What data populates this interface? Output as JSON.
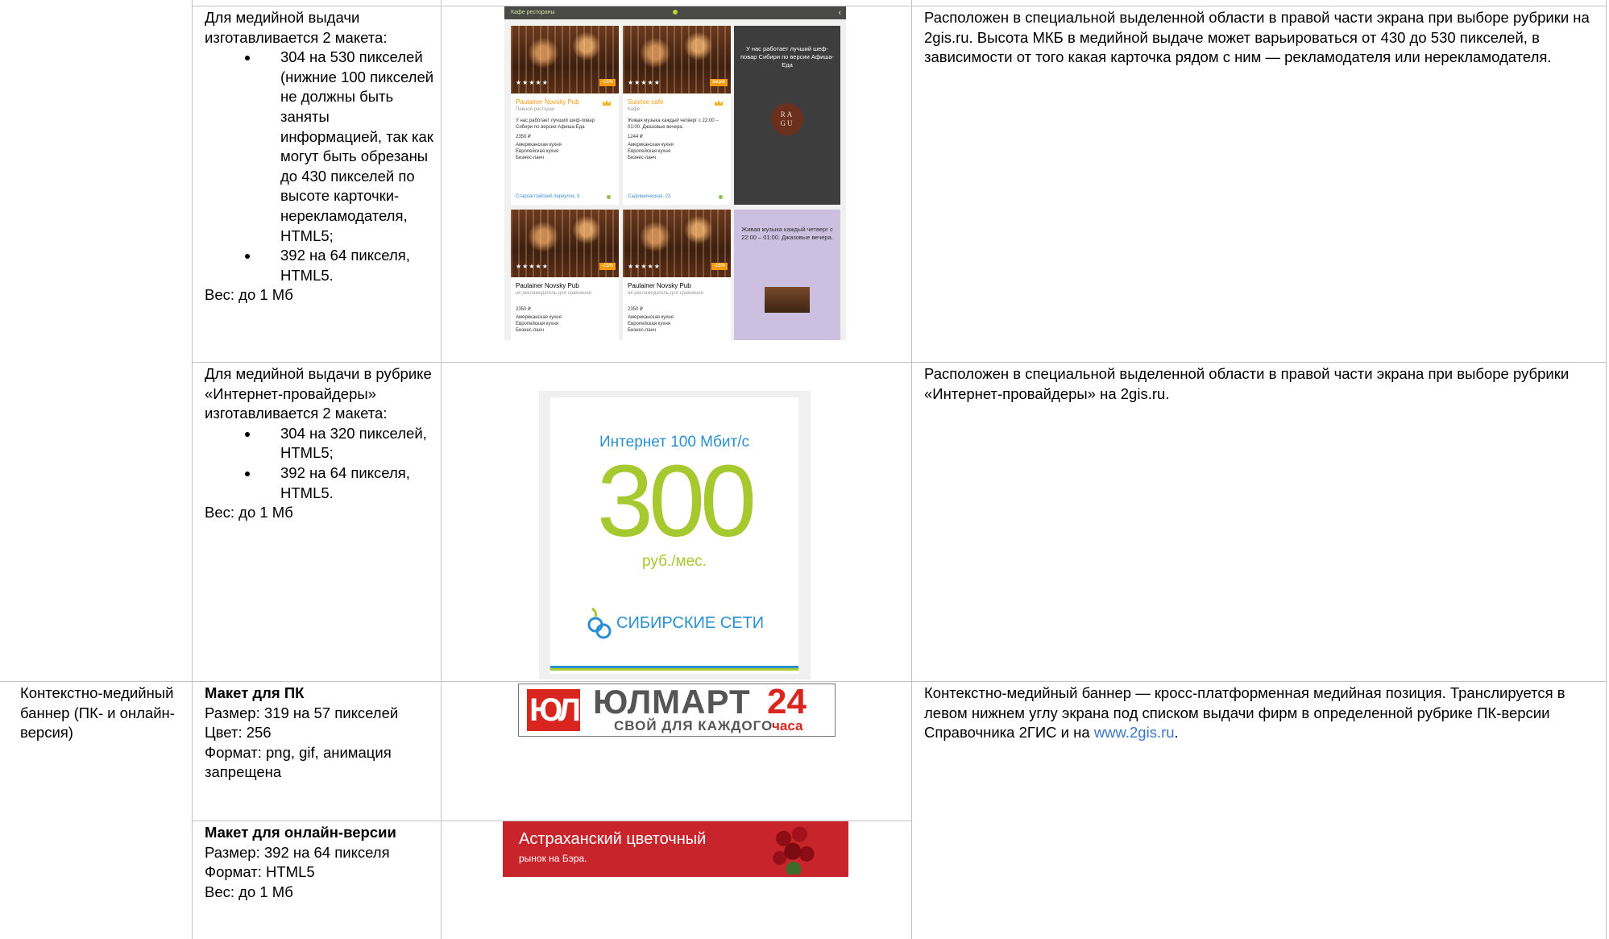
{
  "table": {
    "row1": {
      "col2_intro": "Для медийной выдачи изготавливается 2 макета:",
      "col2_items": [
        "304 на 530 пикселей (нижние 100 пикселей не должны быть заняты информацией, так как могут быть обрезаны до 430 пикселей по высоте карточки-нерекламодателя, HTML5;",
        "392 на 64 пикселя, HTML5."
      ],
      "col2_weight": "Вес: до 1 Мб",
      "col4": "Расположен в специальной выделенной области в правой части экрана при выборе рубрики на 2gis.ru. Высота МКБ в медийной выдаче может варьироваться от 430 до 530 пикселей, в зависимости от того какая карточка рядом с ним — рекламодателя или нерекламодателя."
    },
    "row2": {
      "col2_intro": "Для медийной выдачи в рубрике «Интернет-провайдеры» изготавливается 2 макета:",
      "col2_items": [
        "304 на 320 пикселей, HTML5;",
        "392 на 64 пикселя, HTML5."
      ],
      "col2_weight": "Вес: до 1 Мб",
      "col4": "Расположен в специальной выделенной области в правой части экрана при выборе рубрики «Интернет-провайдеры» на 2gis.ru."
    },
    "row3": {
      "col1": "Контекстно-медийный баннер (ПК- и онлайн-версия)",
      "pc": {
        "heading": "Макет для ПК",
        "lines": [
          "Размер: 319 на 57 пикселей",
          "Цвет: 256",
          "Формат: png, gif, анимация запрещена"
        ]
      },
      "online": {
        "heading": "Макет для онлайн-версии",
        "lines": [
          "Размер: 392 на 64 пикселя",
          "Формат: HTML5",
          "Вес: до 1 Мб"
        ]
      },
      "col4_before": "Контекстно-медийный баннер — кросс-платформенная медийная позиция. Транслируется в левом нижнем углу экрана под списком выдачи фирм в определенной рубрике ПК-версии Справочника 2ГИС и на ",
      "col4_link": "www.2gis.ru",
      "col4_after": "."
    }
  },
  "mockup1": {
    "bar_title": "Кафе рестораны",
    "cards": [
      {
        "title": "Paulainer Novsky Pub",
        "sub": "Пивной ресторан",
        "text": "У нас работает лучший шеф-повар Сибири по версии Афиша-Еда",
        "price": "2350 ₽",
        "cuisine": "Американская кухня\nЕвропейская кухня\nБизнес-ланч",
        "addr": "Староалтайский переулок, 5",
        "badge": "-15%",
        "stars": "★★★★★"
      },
      {
        "title": "Sunrise cafe",
        "sub": "Кафе",
        "text": "Живая музыка каждый четверг с 22:00 – 01:00. Джазовые вечера.",
        "price": "1244 ₽",
        "cuisine": "Американская кухня\nЕвропейская кухня\nБизнес-ланч",
        "addr": "Садовническая, 23",
        "badge": "акция",
        "stars": "★★★★★"
      },
      {
        "title": "Paulainer Novsky Pub",
        "sub": "не рекламодатель для сравнения",
        "text": "",
        "price": "2350 ₽",
        "cuisine": "Американская кухня\nЕвропейская кухня\nБизнес-ланч",
        "addr": "",
        "badge": "-15%",
        "stars": "★★★★★"
      },
      {
        "title": "Paulainer Novsky Pub",
        "sub": "не рекламодатель для сравнения",
        "text": "",
        "price": "2350 ₽",
        "cuisine": "Американская кухня\nЕвропейская кухня\nБизнес-ланч",
        "addr": "",
        "badge": "-15%",
        "stars": "★★★★★"
      }
    ],
    "dark_ad": "У нас работает лучший шеф-повар Сибири по версии Афиша-Еда",
    "ragu": "RA\nGU",
    "lilac_ad": "Живая музыка каждый четверг с 22:00 – 01:00. Джазовые вечера."
  },
  "isp_banner": {
    "headline": "Интернет 100 Мбит/с",
    "price": "300",
    "unit": "руб./мес.",
    "brand": "СИБИРСКИЕ СЕТИ"
  },
  "ulmart_banner": {
    "logo": "ЮЛ",
    "name": "ЮЛМАРТ",
    "slogan": "СВОЙ ДЛЯ КАЖДОГО",
    "num": "24",
    "unit": "часа"
  },
  "flower_banner": {
    "title": "Астраханский цветочный",
    "sub": "рынок на Бэра."
  },
  "colors": {
    "grid": "#c3c3c3",
    "link": "#3b77c8",
    "isp_blue": "#2a8fd1",
    "isp_green": "#a5c92e",
    "ulmart_red": "#d8261f",
    "flower_red": "#c8242c"
  }
}
